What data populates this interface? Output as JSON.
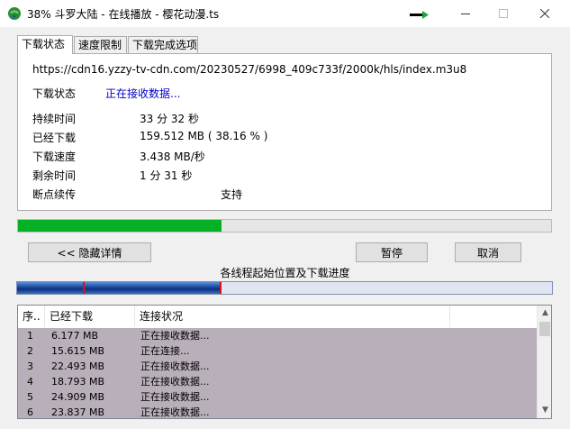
{
  "window": {
    "title": "38% 斗罗大陆 - 在线播放 - 樱花动漫.ts",
    "minimize_icon": "minimize-icon",
    "maximize_icon": "maximize-icon",
    "close_icon": "close-icon"
  },
  "tabs": [
    {
      "label": "下载状态",
      "active": true
    },
    {
      "label": "速度限制",
      "active": false
    },
    {
      "label": "下载完成选项",
      "active": false
    }
  ],
  "status": {
    "url": "https://cdn16.yzzy-tv-cdn.com/20230527/6998_409c733f/2000k/hls/index.m3u8",
    "status_label": "下载状态",
    "status_value": "正在接收数据...",
    "duration_label": "持续时间",
    "duration_value": "33 分 32 秒",
    "downloaded_label": "已经下载",
    "downloaded_value": "159.512  MB  ( 38.16 % )",
    "speed_label": "下载速度",
    "speed_value": "3.438  MB/秒",
    "remaining_label": "剩余时间",
    "remaining_value": "1 分 31 秒",
    "resume_label": "断点续传",
    "resume_value": "支持"
  },
  "progress": {
    "percent": 38.16,
    "color": "#06b025"
  },
  "buttons": {
    "details": "<< 隐藏详情",
    "pause": "暂停",
    "cancel": "取消"
  },
  "threads": {
    "title": "各线程起始位置及下载进度",
    "progress_percent": 38.16
  },
  "list": {
    "columns": [
      "序..",
      "已经下载",
      "连接状况"
    ],
    "rows": [
      {
        "n": "1",
        "size": "6.177  MB",
        "status": "正在接收数据..."
      },
      {
        "n": "2",
        "size": "15.615  MB",
        "status": "正在连接..."
      },
      {
        "n": "3",
        "size": "22.493  MB",
        "status": "正在接收数据..."
      },
      {
        "n": "4",
        "size": "18.793  MB",
        "status": "正在接收数据..."
      },
      {
        "n": "5",
        "size": "24.909  MB",
        "status": "正在接收数据..."
      },
      {
        "n": "6",
        "size": "23.837  MB",
        "status": "正在接收数据..."
      }
    ],
    "row_color": "#b9afba"
  }
}
